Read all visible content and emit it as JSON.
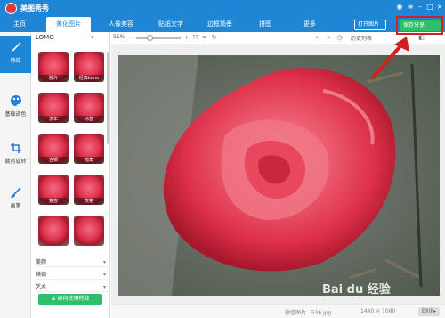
{
  "app": {
    "title": "美图秀秀"
  },
  "nav": {
    "tabs": [
      {
        "label": "主页"
      },
      {
        "label": "美化图片"
      },
      {
        "label": "人像美容"
      },
      {
        "label": "贴纸文字"
      },
      {
        "label": "边框场景"
      },
      {
        "label": "拼图"
      },
      {
        "label": "更多"
      }
    ],
    "open_image": "打开图片",
    "save_share": "保存分享"
  },
  "tools": [
    {
      "label": "特效",
      "icon": "magic-wand-icon"
    },
    {
      "label": "基础调色",
      "icon": "palette-icon"
    },
    {
      "label": "裁剪旋转",
      "icon": "crop-icon"
    },
    {
      "label": "画笔",
      "icon": "brush-icon"
    }
  ],
  "effects": {
    "selected": "LOMO",
    "items": [
      {
        "label": "胶片"
      },
      {
        "label": "经典lomo"
      },
      {
        "label": "流年"
      },
      {
        "label": "冰蓝"
      },
      {
        "label": "古铜"
      },
      {
        "label": "暗角"
      },
      {
        "label": "复古"
      },
      {
        "label": "优格"
      },
      {
        "label": "",
        "note": ""
      },
      {
        "label": ""
      }
    ],
    "categories": [
      {
        "label": "美颜"
      },
      {
        "label": "格调"
      },
      {
        "label": "艺术"
      }
    ],
    "tutorial": "✿ 如何使用特效"
  },
  "toolbar": {
    "zoom": "51%",
    "history": "历史列表"
  },
  "status": {
    "file_name": "微信图片...536.jpg",
    "image_size": "1440 × 1080",
    "exif": "EXIF▸"
  },
  "watermark": "Bai du 经验",
  "colors": {
    "title_bar": "#1f86d6",
    "save_button": "#2fbe6a",
    "highlight": "#d21f1f"
  }
}
